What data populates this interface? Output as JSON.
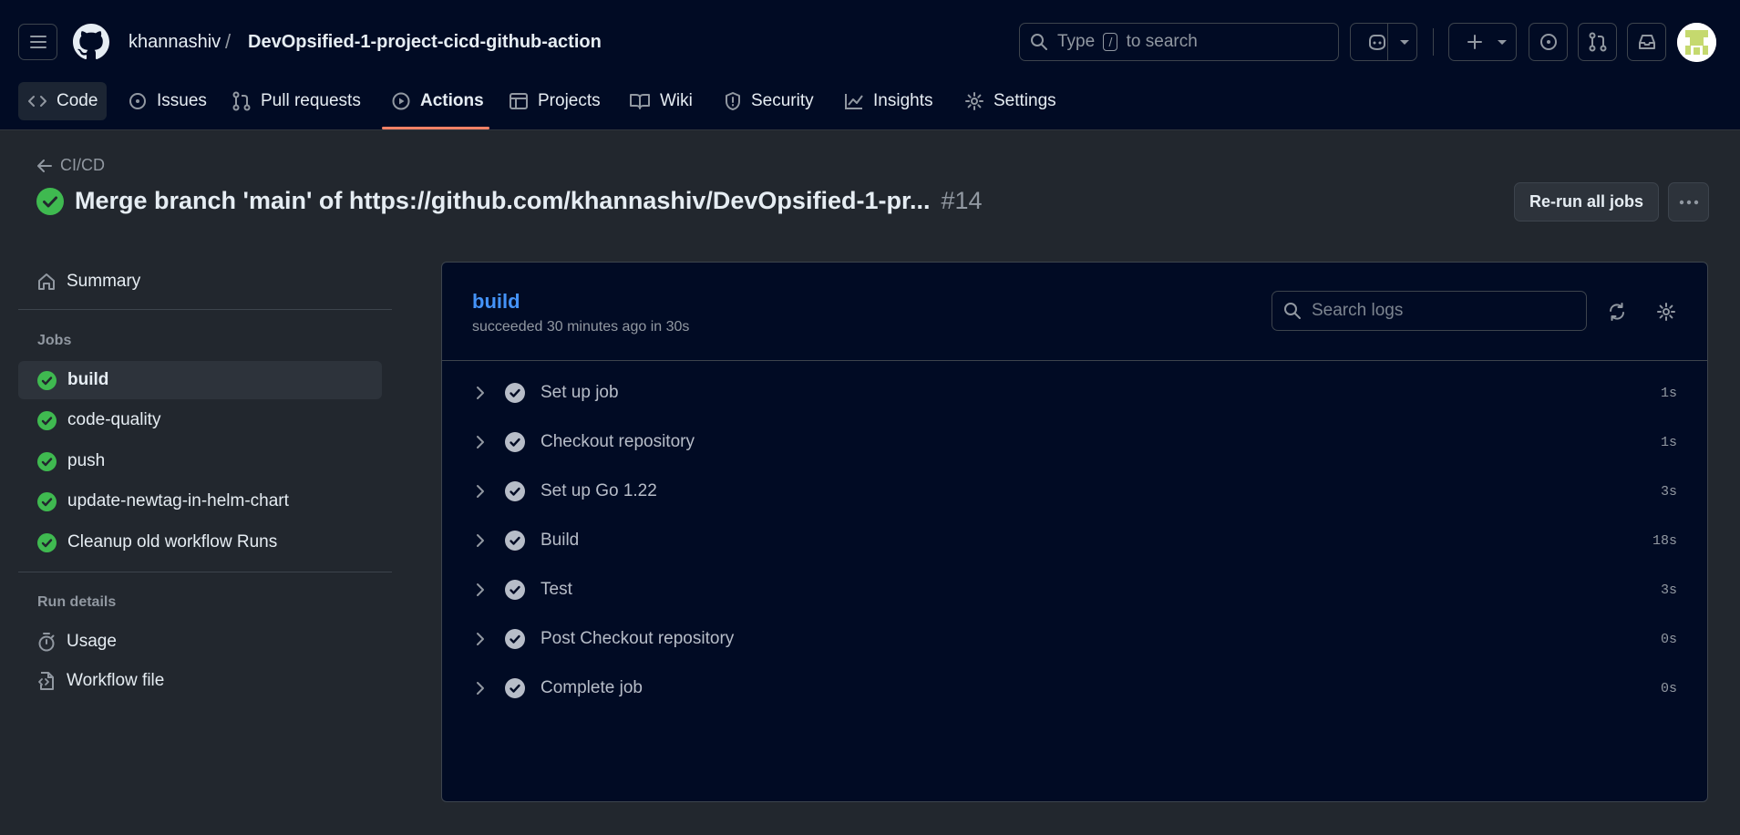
{
  "header": {
    "owner": "khannashiv",
    "separator": "/",
    "repo": "DevOpsified-1-project-cicd-github-action",
    "search": {
      "prefix": "Type",
      "key": "/",
      "suffix": "to search"
    }
  },
  "nav": {
    "tabs": [
      {
        "label": "Code",
        "icon": "code-icon"
      },
      {
        "label": "Issues",
        "icon": "issue-icon"
      },
      {
        "label": "Pull requests",
        "icon": "pull-request-icon"
      },
      {
        "label": "Actions",
        "icon": "play-icon",
        "active": true
      },
      {
        "label": "Projects",
        "icon": "table-icon"
      },
      {
        "label": "Wiki",
        "icon": "book-icon"
      },
      {
        "label": "Security",
        "icon": "shield-icon"
      },
      {
        "label": "Insights",
        "icon": "graph-icon"
      },
      {
        "label": "Settings",
        "icon": "gear-icon"
      }
    ]
  },
  "run": {
    "back_label": "CI/CD",
    "title": "Merge branch 'main' of https://github.com/khannashiv/DevOpsified-1-pr...",
    "number": "#14",
    "rerun_label": "Re-run all jobs"
  },
  "sidebar": {
    "summary": "Summary",
    "jobs_heading": "Jobs",
    "jobs": [
      "build",
      "code-quality",
      "push",
      "update-newtag-in-helm-chart",
      "Cleanup old workflow Runs"
    ],
    "run_details_heading": "Run details",
    "details": [
      "Usage",
      "Workflow file"
    ]
  },
  "job": {
    "name": "build",
    "status": "succeeded 30 minutes ago in 30s",
    "search_placeholder": "Search logs",
    "steps": [
      {
        "label": "Set up job",
        "duration": "1s"
      },
      {
        "label": "Checkout repository",
        "duration": "1s"
      },
      {
        "label": "Set up Go 1.22",
        "duration": "3s"
      },
      {
        "label": "Build",
        "duration": "18s"
      },
      {
        "label": "Test",
        "duration": "3s"
      },
      {
        "label": "Post Checkout repository",
        "duration": "0s"
      },
      {
        "label": "Complete job",
        "duration": "0s"
      }
    ]
  },
  "colors": {
    "header_bg": "#010b24",
    "page_bg": "#22272e",
    "success": "#3fb950",
    "accent_link": "#4493f8",
    "tab_underline": "#f78166"
  }
}
